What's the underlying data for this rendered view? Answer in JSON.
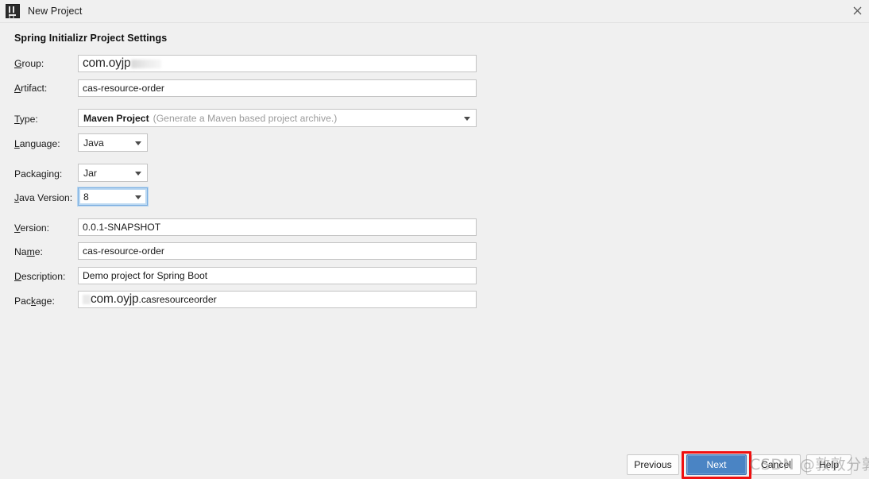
{
  "window": {
    "title": "New Project",
    "icon": "intellij-idea-icon",
    "close_icon": "close-icon"
  },
  "header": {
    "title": "Spring Initializr Project Settings"
  },
  "form": {
    "fields": [
      {
        "id": "group",
        "label": "Group:",
        "mnemonic": "G",
        "kind": "text",
        "value": "com.oyjp",
        "redacted": true,
        "blurred": true
      },
      {
        "id": "artifact",
        "label": "Artifact:",
        "mnemonic": "A",
        "kind": "text",
        "value": "cas-resource-order"
      },
      {
        "id": "type",
        "label": "Type:",
        "mnemonic": "T",
        "kind": "combo-wide",
        "value": "Maven Project",
        "hint": "(Generate a Maven based project archive.)"
      },
      {
        "id": "language",
        "label": "Language:",
        "mnemonic": "L",
        "kind": "combo-narrow",
        "value": "Java"
      },
      {
        "id": "packaging",
        "label": "Packaging:",
        "mnemonic": "g",
        "kind": "combo-narrow",
        "value": "Jar"
      },
      {
        "id": "java-version",
        "label": "Java Version:",
        "mnemonic": "J",
        "kind": "combo-narrow",
        "value": "8",
        "focused": true
      },
      {
        "id": "version",
        "label": "Version:",
        "mnemonic": "V",
        "kind": "text",
        "value": "0.0.1-SNAPSHOT"
      },
      {
        "id": "name",
        "label": "Name:",
        "mnemonic": "m",
        "kind": "text",
        "value": "cas-resource-order"
      },
      {
        "id": "description",
        "label": "Description:",
        "mnemonic": "D",
        "kind": "text",
        "value": "Demo project for Spring Boot"
      },
      {
        "id": "package",
        "label": "Package:",
        "mnemonic": "k",
        "kind": "text",
        "value_prefix": "com.oyjp",
        "value_suffix": ".casresourceorder",
        "blurred": true
      }
    ]
  },
  "buttons": {
    "previous": "Previous",
    "next": "Next",
    "cancel": "Cancel",
    "help": "Help"
  },
  "annotation": {
    "highlight_target": "next-button",
    "color": "#f01010"
  },
  "watermark": {
    "text": "CSDN @敦敦分敦"
  },
  "colors": {
    "dialog_background": "#f0f0f0",
    "field_background": "#ffffff",
    "field_border": "#c4c4c4",
    "primary_button": "#4a84c4",
    "focus_ring": "#7daee0",
    "annotation_red": "#f01010"
  }
}
